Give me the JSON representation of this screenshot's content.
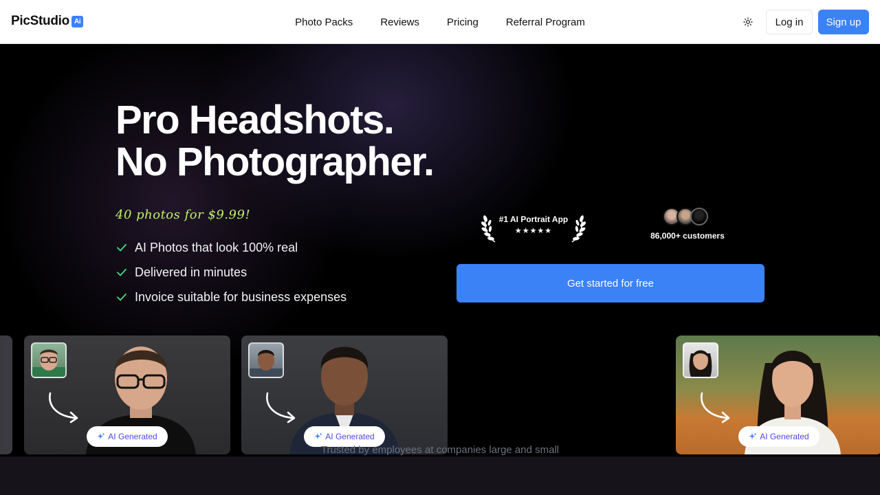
{
  "brand": {
    "name": "PicStudio",
    "badge": "Ai"
  },
  "nav": {
    "links": [
      "Photo Packs",
      "Reviews",
      "Pricing",
      "Referral Program"
    ],
    "theme_icon": "sun-icon",
    "login": "Log in",
    "signup": "Sign up"
  },
  "hero": {
    "headline_line1": "Pro Headshots.",
    "headline_line2": "No Photographer.",
    "promo": "40 photos for $9.99!",
    "features": [
      "AI Photos that look 100% real",
      "Delivered in minutes",
      "Invoice suitable for business expenses"
    ],
    "award": {
      "title": "#1 AI Portrait App",
      "stars": "★★★★★"
    },
    "customers": {
      "text": "86,000+ customers"
    },
    "cta": "Get started for free"
  },
  "cards": {
    "badge": "AI Generated"
  },
  "trusted": "Trusted by employees at companies large and small",
  "colors": {
    "accent": "#3b82f6",
    "promo": "#bef264",
    "check": "#4ade80"
  }
}
